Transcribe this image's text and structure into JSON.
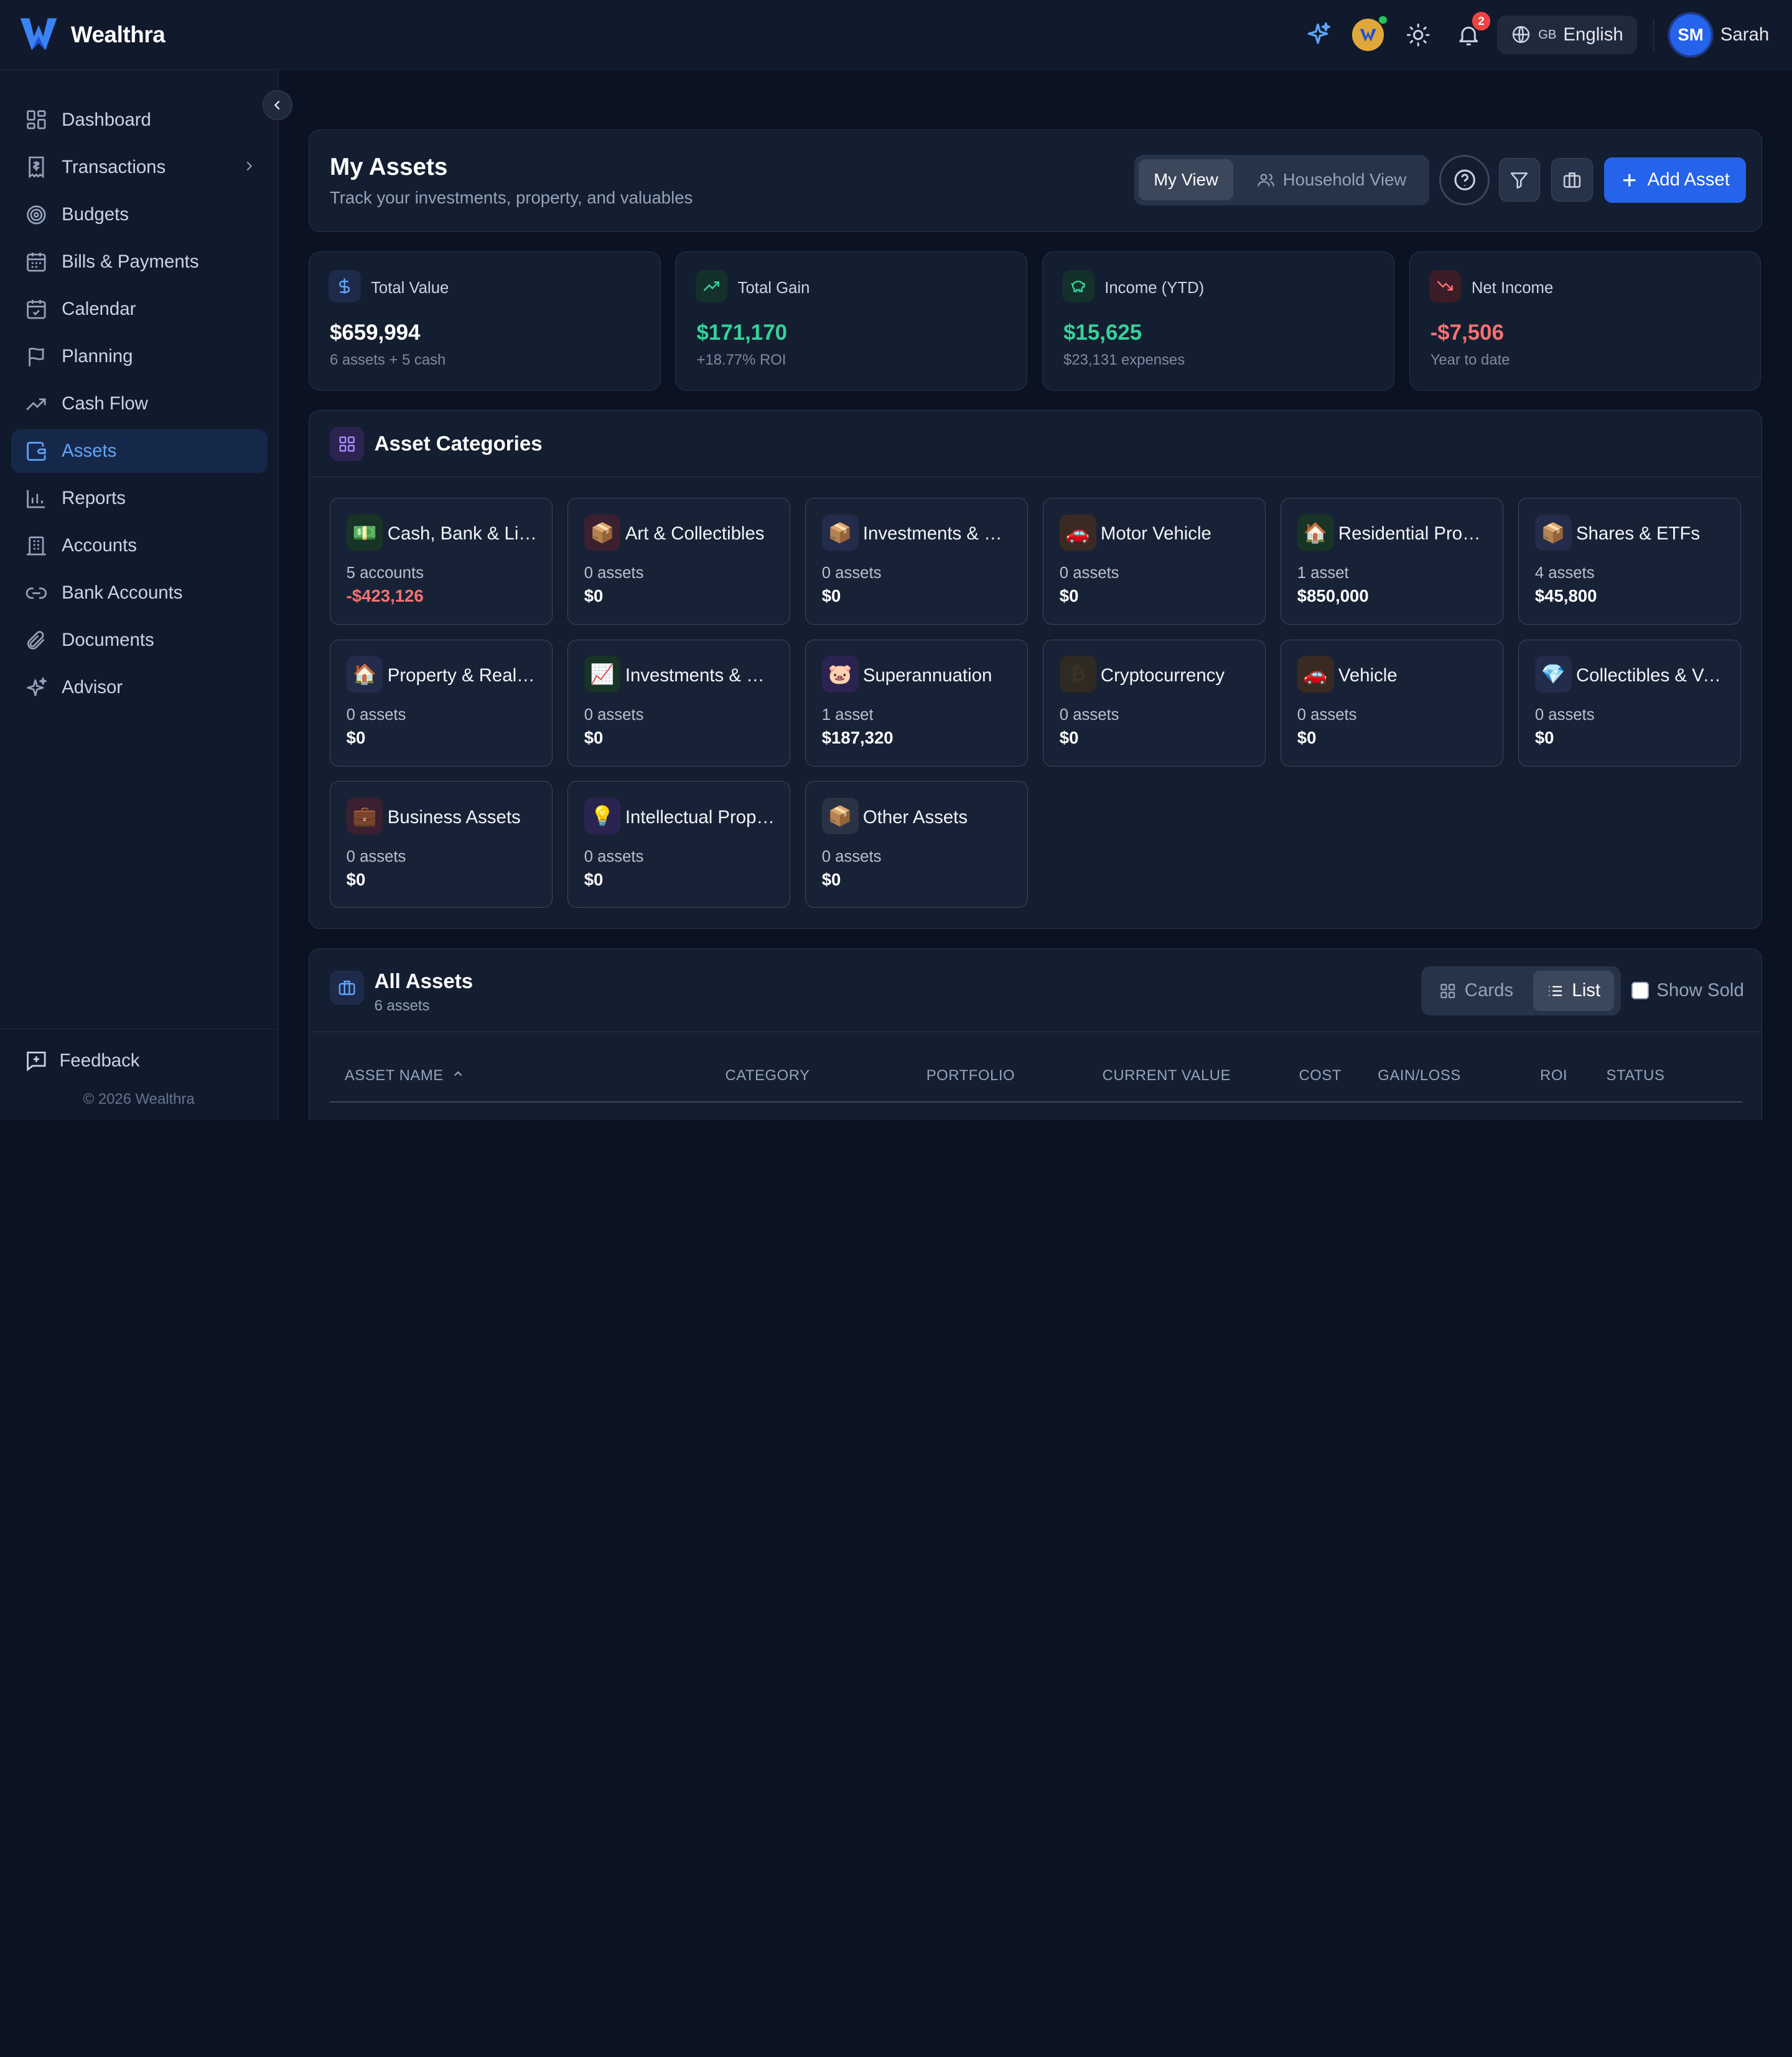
{
  "brand": {
    "name": "Wealthra"
  },
  "topbar": {
    "notifications_count": "2",
    "language_flag": "GB",
    "language": "English",
    "user_initials": "SM",
    "user_name": "Sarah"
  },
  "sidebar": {
    "items": [
      {
        "label": "Dashboard",
        "icon": "dashboard-icon"
      },
      {
        "label": "Transactions",
        "icon": "receipt-icon"
      },
      {
        "label": "Budgets",
        "icon": "target-icon"
      },
      {
        "label": "Bills & Payments",
        "icon": "calendar-icon"
      },
      {
        "label": "Calendar",
        "icon": "calendar-check-icon"
      },
      {
        "label": "Planning",
        "icon": "flag-icon"
      },
      {
        "label": "Cash Flow",
        "icon": "trending-up-icon"
      },
      {
        "label": "Assets",
        "icon": "wallet-icon"
      },
      {
        "label": "Reports",
        "icon": "bar-chart-icon"
      },
      {
        "label": "Accounts",
        "icon": "building-icon"
      },
      {
        "label": "Bank Accounts",
        "icon": "link-icon"
      },
      {
        "label": "Documents",
        "icon": "paperclip-icon"
      },
      {
        "label": "Advisor",
        "icon": "sparkles-icon"
      }
    ],
    "feedback": "Feedback",
    "copyright": "© 2026 Wealthra"
  },
  "header": {
    "title": "My Assets",
    "subtitle": "Track your investments, property, and valuables",
    "my_view": "My View",
    "household_view": "Household View",
    "add_asset": "Add Asset"
  },
  "stats": [
    {
      "label": "Total Value",
      "value": "$659,994",
      "sub": "6 assets + 5 cash",
      "color": "#ffffff"
    },
    {
      "label": "Total Gain",
      "value": "$171,170",
      "sub": "+18.77% ROI",
      "color": "#34d399"
    },
    {
      "label": "Income (YTD)",
      "value": "$15,625",
      "sub": "$23,131 expenses",
      "color": "#34d399"
    },
    {
      "label": "Net Income",
      "value": "-$7,506",
      "sub": "Year to date",
      "color": "#f87171"
    }
  ],
  "categories": {
    "title": "Asset Categories",
    "items": [
      {
        "name": "Cash, Bank & Liquid",
        "count": "5 accounts",
        "value": "-$423,126",
        "emoji": "💵"
      },
      {
        "name": "Art & Collectibles",
        "count": "0 assets",
        "value": "$0",
        "emoji": "📦"
      },
      {
        "name": "Investments & Securities",
        "count": "0 assets",
        "value": "$0",
        "emoji": "📦"
      },
      {
        "name": "Motor Vehicle",
        "count": "0 assets",
        "value": "$0",
        "emoji": "🚗"
      },
      {
        "name": "Residential Property",
        "count": "1 asset",
        "value": "$850,000",
        "emoji": "🏠"
      },
      {
        "name": "Shares & ETFs",
        "count": "4 assets",
        "value": "$45,800",
        "emoji": "📦"
      },
      {
        "name": "Property & Real Estate",
        "count": "0 assets",
        "value": "$0",
        "emoji": "🏠"
      },
      {
        "name": "Investments & Securities",
        "count": "0 assets",
        "value": "$0",
        "emoji": "📈"
      },
      {
        "name": "Superannuation",
        "count": "1 asset",
        "value": "$187,320",
        "emoji": "🐷"
      },
      {
        "name": "Cryptocurrency",
        "count": "0 assets",
        "value": "$0",
        "emoji": "₿"
      },
      {
        "name": "Vehicle",
        "count": "0 assets",
        "value": "$0",
        "emoji": "🚗"
      },
      {
        "name": "Collectibles & Valuables",
        "count": "0 assets",
        "value": "$0",
        "emoji": "💎"
      },
      {
        "name": "Business Assets",
        "count": "0 assets",
        "value": "$0",
        "emoji": "💼"
      },
      {
        "name": "Intellectual Property",
        "count": "0 assets",
        "value": "$0",
        "emoji": "💡"
      },
      {
        "name": "Other Assets",
        "count": "0 assets",
        "value": "$0",
        "emoji": "📦"
      }
    ]
  },
  "all_assets": {
    "title": "All Assets",
    "count": "6 assets",
    "cards": "Cards",
    "list": "List",
    "show_sold": "Show Sold",
    "columns": [
      "ASSET NAME",
      "CATEGORY",
      "PORTFOLIO",
      "CURRENT VALUE",
      "COST",
      "GAIN/LOSS",
      "ROI",
      "STATUS"
    ]
  }
}
